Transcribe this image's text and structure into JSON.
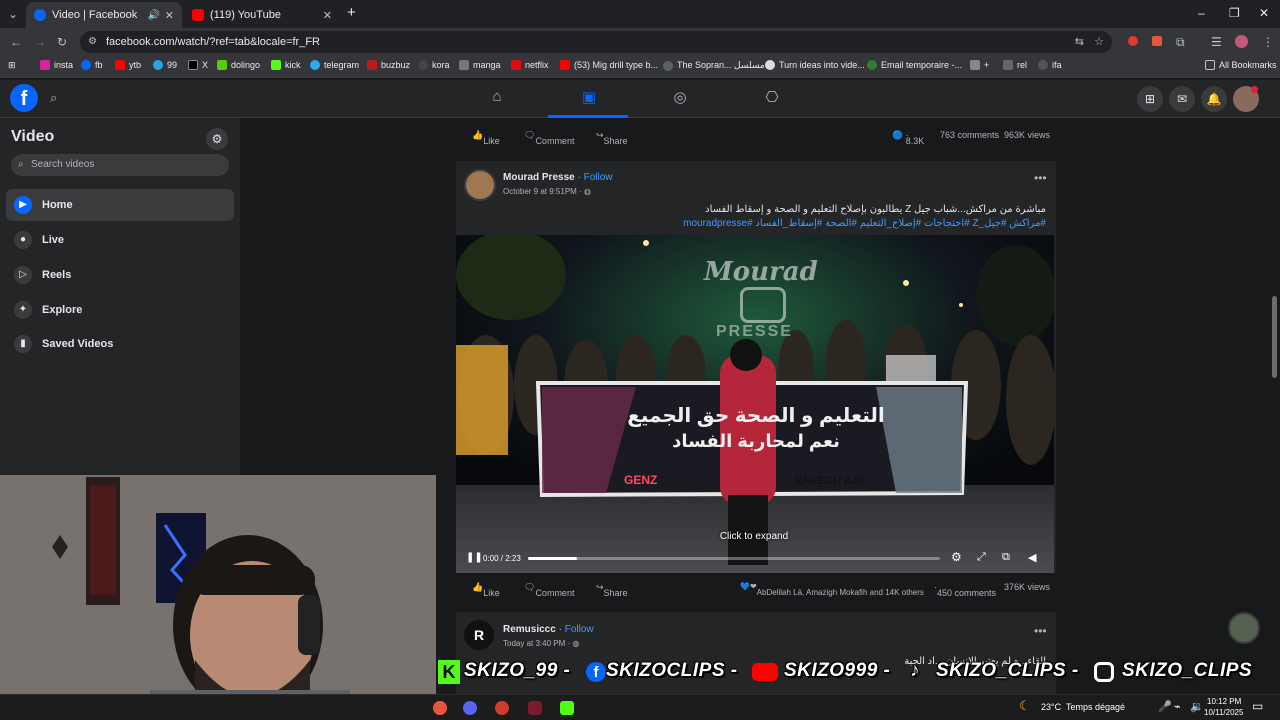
{
  "browser": {
    "tabs": [
      {
        "title": "Video | Facebook",
        "active": true
      },
      {
        "title": "(119) YouTube",
        "active": false
      }
    ],
    "new_tab": "+",
    "url": "facebook.com/watch/?ref=tab&locale=fr_FR",
    "bookmarks": [
      "insta",
      "fb",
      "ytb",
      "99",
      "X",
      "dolingo",
      "kick",
      "telegram",
      "buzbuz",
      "kora",
      "manga",
      "netflix",
      "(53) Mig drill type b...",
      "The Sopran... مسلسل",
      "Turn ideas into vide...",
      "Email temporaire -...",
      "+",
      "rel",
      "ifa"
    ],
    "all_bookmarks": "All Bookmarks"
  },
  "sidebar": {
    "title": "Video",
    "search_placeholder": "Search videos",
    "items": [
      {
        "label": "Home"
      },
      {
        "label": "Live"
      },
      {
        "label": "Reels"
      },
      {
        "label": "Explore"
      },
      {
        "label": "Saved Videos"
      }
    ]
  },
  "feed": {
    "actions": {
      "like": "Like",
      "comment": "Comment",
      "share": "Share"
    },
    "prev_post": {
      "reactions": "8.3K",
      "comments": "763 comments",
      "views": "963K views"
    },
    "post": {
      "author": "Mourad Presse",
      "follow": "Follow",
      "dot": "·",
      "date": "October 9 at 9:51PM",
      "text": "مباشرة من مراكش...شباب جيل Z يطالبون بإصلاح التعليم و الصحة و إسقاط الفساد",
      "hashtags": "#مراكش #جيل_Z #احتجاجات #إصلاح_التعليم #الصحة #إسقاط_الفساد #mouradpresse",
      "video": {
        "watermark_top": "Mourad",
        "watermark_bottom": "PRESSE",
        "banner_line1": "التعليم و الصحة حق الجميع",
        "banner_line2": "نعم لمحاربة الفساد",
        "banner_tag_left": "GENZ",
        "banner_tag_right": "RAKECH A26",
        "click_to_expand": "Click to expand",
        "time": "0:00 / 2:23",
        "progress": 0.12
      },
      "reactions_text": "AbDelilah Lā, Amazigh Mokafih and 14K others",
      "comments": "450 comments",
      "views": "376K views"
    },
    "next_post": {
      "author": "Remusiccc",
      "follow": "Follow",
      "date": "Today at 3:40 PM",
      "text": "إلقاء...ه لم يعتبر الإنسان ...اد الحبة"
    }
  },
  "overlay": {
    "banner_segments": [
      "SKIZO_99 -",
      "SKIZOCLIPS -",
      "SKIZO999 -",
      "SKIZO_CLIPS -",
      "SKIZO_CLIPS"
    ]
  },
  "taskbar": {
    "weather": "23°C",
    "weather_text": "Temps dégagé",
    "time": "10:12 PM",
    "date": "10/11/2025"
  },
  "colors": {
    "fb_blue": "#0866ff",
    "bg_dark": "#18191a",
    "surface": "#242526",
    "link": "#4599ff"
  }
}
